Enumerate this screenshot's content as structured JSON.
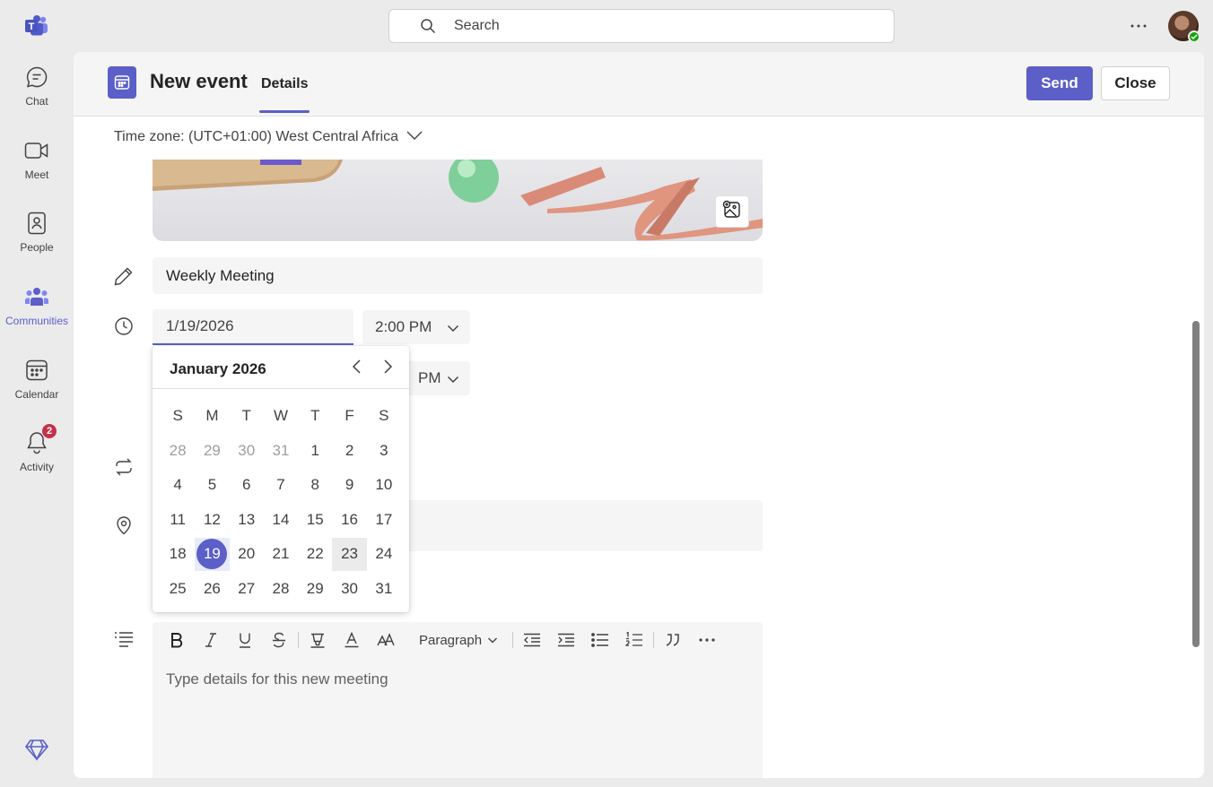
{
  "rail": {
    "items": [
      {
        "label": "Chat",
        "icon": "chat-icon"
      },
      {
        "label": "Meet",
        "icon": "video-camera-icon"
      },
      {
        "label": "People",
        "icon": "contact-card-icon"
      },
      {
        "label": "Communities",
        "icon": "communities-icon"
      },
      {
        "label": "Calendar",
        "icon": "calendar-icon"
      },
      {
        "label": "Activity",
        "icon": "bell-icon",
        "badge": "2"
      }
    ]
  },
  "search": {
    "placeholder": "Search"
  },
  "header": {
    "title": "New event",
    "tab": "Details",
    "send_label": "Send",
    "close_label": "Close"
  },
  "form": {
    "timezone": "Time zone: (UTC+01:00) West Central Africa",
    "title_value": "Weekly Meeting",
    "start_date": "1/19/2026",
    "start_time": "2:00 PM",
    "end_time_partial": "PM",
    "details_placeholder": "Type details for this new meeting"
  },
  "editor": {
    "paragraph_label": "Paragraph"
  },
  "calendar": {
    "month_label": "January 2026",
    "weekdays": [
      "S",
      "M",
      "T",
      "W",
      "T",
      "F",
      "S"
    ],
    "weeks": [
      [
        "28",
        "29",
        "30",
        "31",
        "1",
        "2",
        "3"
      ],
      [
        "4",
        "5",
        "6",
        "7",
        "8",
        "9",
        "10"
      ],
      [
        "11",
        "12",
        "13",
        "14",
        "15",
        "16",
        "17"
      ],
      [
        "18",
        "19",
        "20",
        "21",
        "22",
        "23",
        "24"
      ],
      [
        "25",
        "26",
        "27",
        "28",
        "29",
        "30",
        "31"
      ]
    ],
    "muted_first_week_count": 4,
    "selected_day": "19",
    "hovered_day": "23"
  },
  "colors": {
    "accent": "#5b5fc7",
    "badge": "#c4314b",
    "presence": "#13a10e"
  }
}
